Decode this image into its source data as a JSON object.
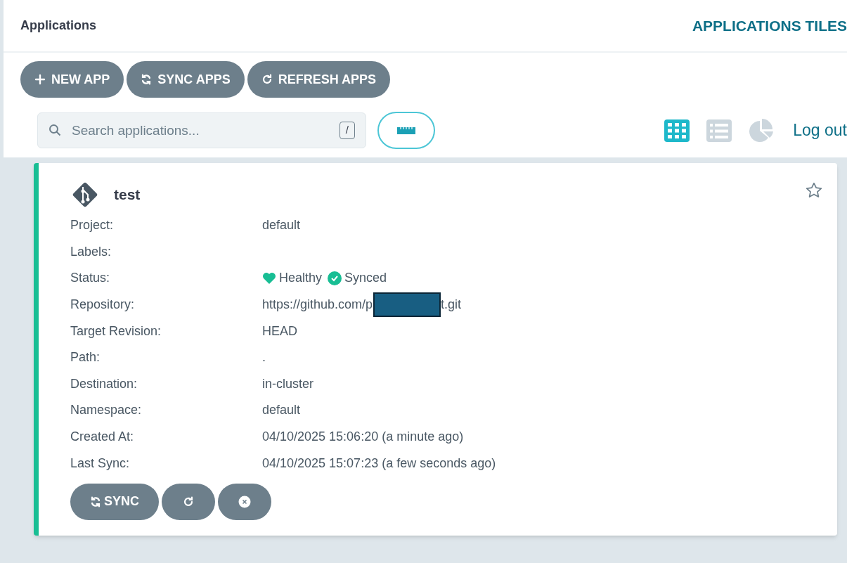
{
  "header": {
    "title": "Applications",
    "view_title": "APPLICATIONS TILES"
  },
  "toolbar": [
    {
      "kind": "plus",
      "label": "NEW APP"
    },
    {
      "kind": "sync",
      "label": "SYNC APPS"
    },
    {
      "kind": "refresh",
      "label": "REFRESH APPS"
    }
  ],
  "search": {
    "placeholder": "Search applications...",
    "shortcut": "/"
  },
  "views": [
    {
      "kind": "tiles",
      "selected": true
    },
    {
      "kind": "list",
      "selected": false
    },
    {
      "kind": "summary",
      "selected": false
    }
  ],
  "logout": "Log out",
  "app": {
    "name": "test",
    "favorite": false,
    "fields": [
      {
        "label": "Project:",
        "value": "default"
      },
      {
        "label": "Labels:"
      },
      {
        "label": "Status:",
        "kind": "status",
        "health": "Healthy",
        "sync": "Synced"
      },
      {
        "label": "Repository:",
        "value": "https://github.com/p",
        "redacted": true,
        "value_after": "t.git"
      },
      {
        "label": "Target Revision:",
        "value": "HEAD"
      },
      {
        "label": "Path:",
        "value": "."
      },
      {
        "label": "Destination:",
        "value": "in-cluster"
      },
      {
        "label": "Namespace:",
        "value": "default"
      },
      {
        "label": "Created At:",
        "value": "04/10/2025 15:06:20  (a minute ago)"
      },
      {
        "label": "Last Sync:",
        "value": "04/10/2025 15:07:23  (a few seconds ago)"
      }
    ],
    "actions": [
      {
        "kind": "sync",
        "label": "SYNC"
      },
      {
        "kind": "refresh"
      },
      {
        "kind": "delete"
      }
    ]
  }
}
